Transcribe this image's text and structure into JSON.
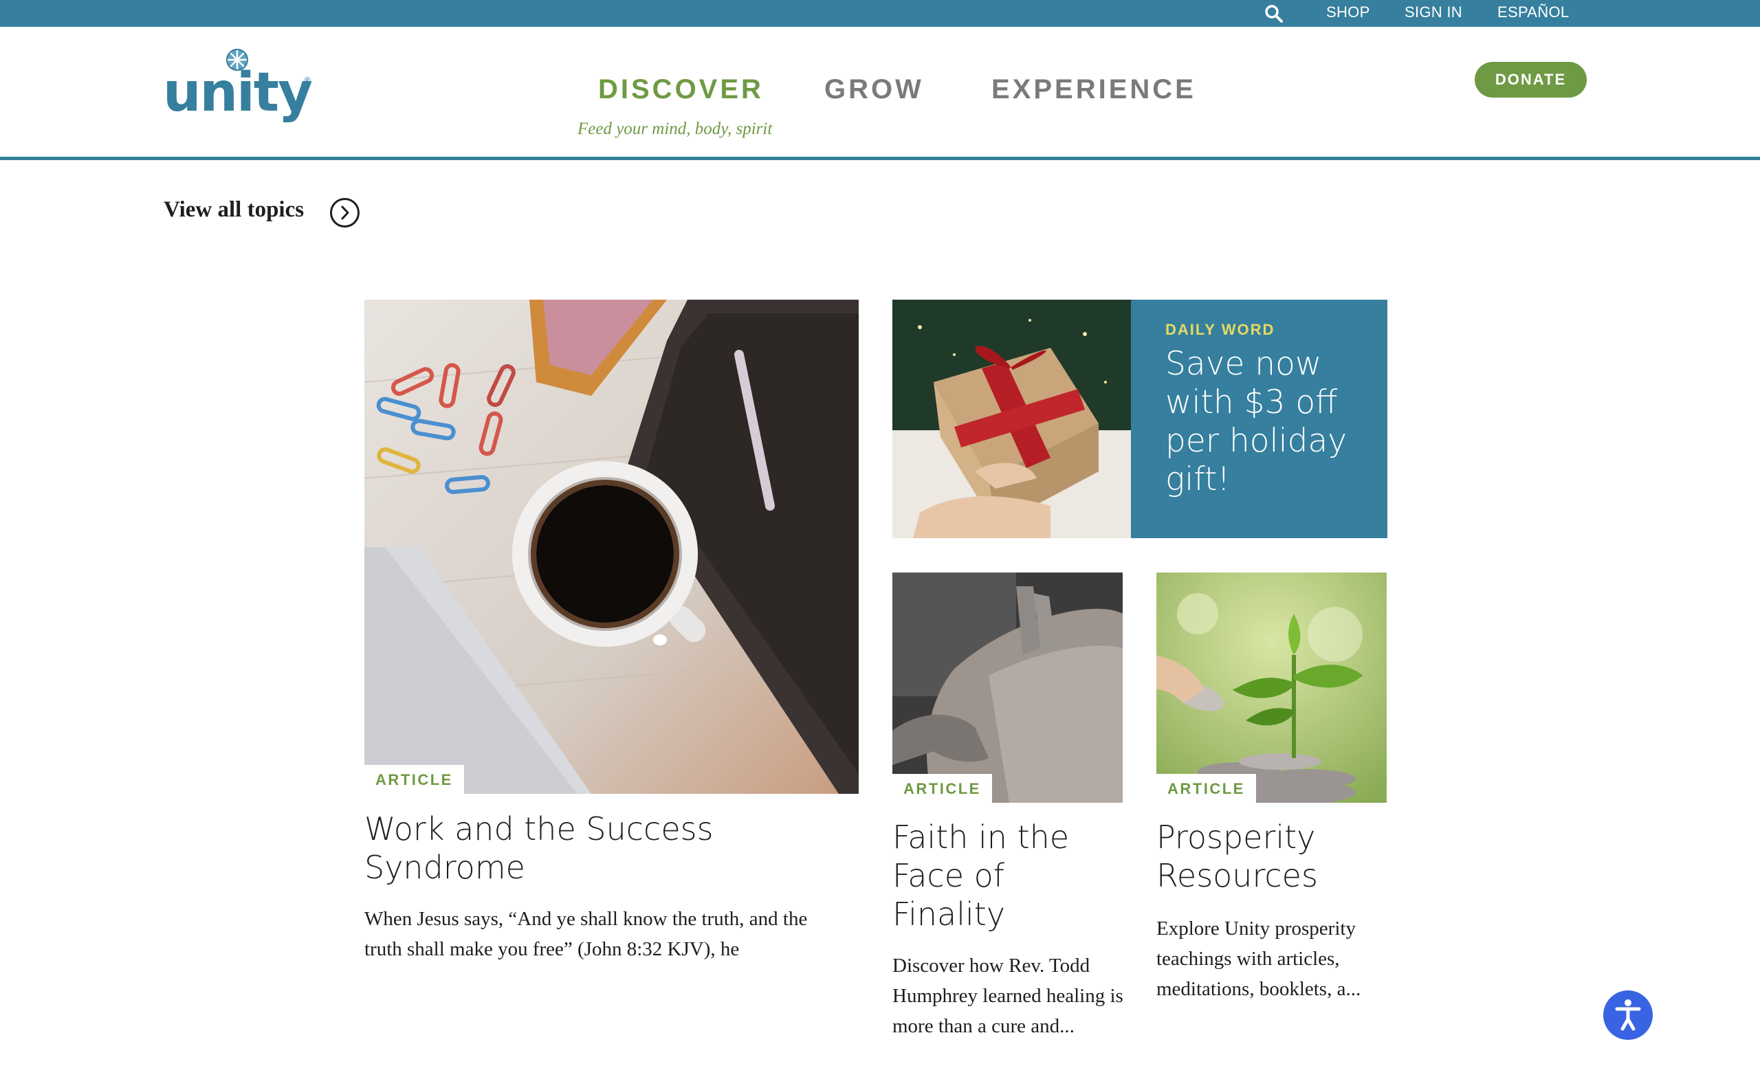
{
  "topbar": {
    "shop": "SHOP",
    "sign_in": "SIGN IN",
    "espanol": "ESPAÑOL",
    "search_icon": "search-icon"
  },
  "header": {
    "logo_text": "unity",
    "nav": [
      {
        "label": "DISCOVER",
        "sub": "Feed your mind, body, spirit"
      },
      {
        "label": "GROW"
      },
      {
        "label": "EXPERIENCE"
      }
    ],
    "donate": "DONATE"
  },
  "view_all": {
    "label": "View all topics",
    "icon": "chevron-right-circle-icon"
  },
  "featured": {
    "tag": "ARTICLE",
    "title": "Work and the Success Syndrome",
    "desc": "When Jesus says, “And ye shall know the truth, and the truth shall make you free” (John 8:32 KJV), he"
  },
  "promo": {
    "label": "DAILY WORD",
    "title": "Save now with $3 off per holiday gift!"
  },
  "card_faith": {
    "tag": "ARTICLE",
    "title": "Faith in the Face of Finality",
    "desc": "Discover how Rev. Todd Humphrey learned healing is more than a cure and..."
  },
  "card_prosperity": {
    "tag": "ARTICLE",
    "title": "Prosperity Resources",
    "desc": "Explore Unity prosperity teachings with articles, meditations, booklets, a..."
  },
  "colors": {
    "brand_teal": "#367f9e",
    "brand_green": "#6f9a43",
    "promo_yellow": "#e9d960",
    "a11y_blue": "#3864e3"
  },
  "accessibility_icon": "accessibility-icon"
}
